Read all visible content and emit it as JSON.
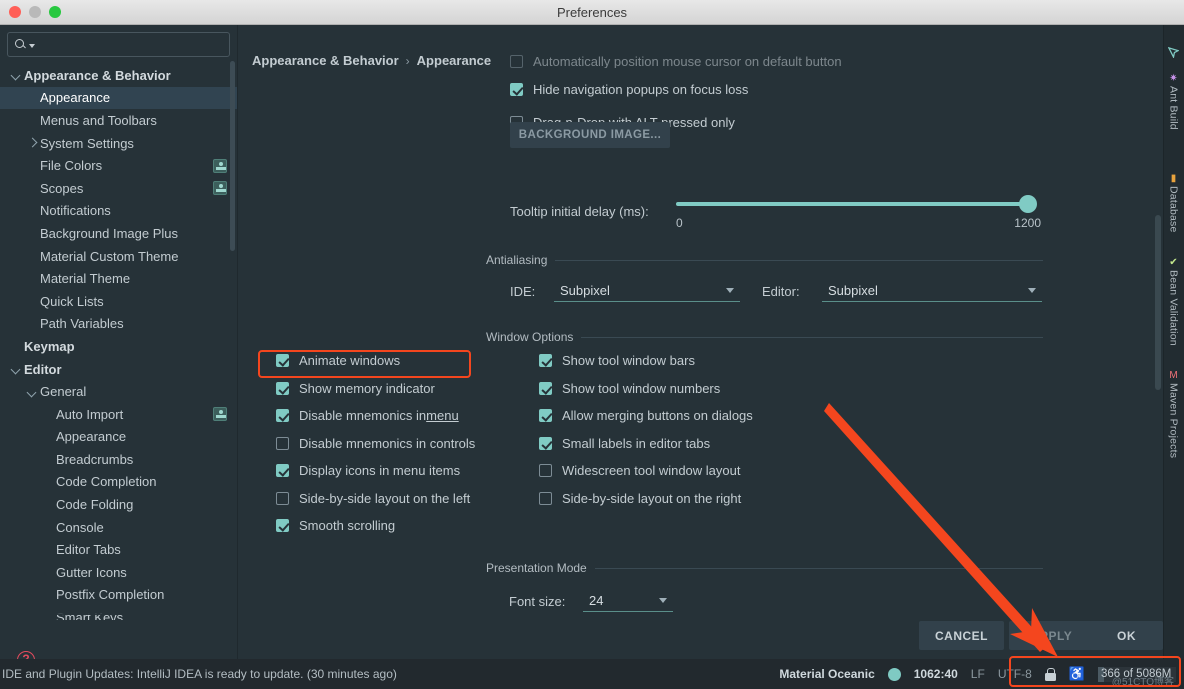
{
  "window": {
    "title": "Preferences"
  },
  "search": {
    "value": "",
    "placeholder": ""
  },
  "sidebar": {
    "items": [
      {
        "label": "Appearance & Behavior",
        "indent": 0,
        "twisty": "down",
        "bold": true,
        "selected": false,
        "badge": false
      },
      {
        "label": "Appearance",
        "indent": 1,
        "twisty": "none",
        "bold": false,
        "selected": true,
        "badge": false
      },
      {
        "label": "Menus and Toolbars",
        "indent": 1,
        "twisty": "none",
        "bold": false,
        "selected": false,
        "badge": false
      },
      {
        "label": "System Settings",
        "indent": 1,
        "twisty": "right",
        "bold": false,
        "selected": false,
        "badge": false
      },
      {
        "label": "File Colors",
        "indent": 1,
        "twisty": "none",
        "bold": false,
        "selected": false,
        "badge": true
      },
      {
        "label": "Scopes",
        "indent": 1,
        "twisty": "none",
        "bold": false,
        "selected": false,
        "badge": true
      },
      {
        "label": "Notifications",
        "indent": 1,
        "twisty": "none",
        "bold": false,
        "selected": false,
        "badge": false
      },
      {
        "label": "Background Image Plus",
        "indent": 1,
        "twisty": "none",
        "bold": false,
        "selected": false,
        "badge": false
      },
      {
        "label": "Material Custom Theme",
        "indent": 1,
        "twisty": "none",
        "bold": false,
        "selected": false,
        "badge": false
      },
      {
        "label": "Material Theme",
        "indent": 1,
        "twisty": "none",
        "bold": false,
        "selected": false,
        "badge": false
      },
      {
        "label": "Quick Lists",
        "indent": 1,
        "twisty": "none",
        "bold": false,
        "selected": false,
        "badge": false
      },
      {
        "label": "Path Variables",
        "indent": 1,
        "twisty": "none",
        "bold": false,
        "selected": false,
        "badge": false
      },
      {
        "label": "Keymap",
        "indent": 0,
        "twisty": "none",
        "bold": true,
        "selected": false,
        "badge": false
      },
      {
        "label": "Editor",
        "indent": 0,
        "twisty": "down",
        "bold": true,
        "selected": false,
        "badge": false
      },
      {
        "label": "General",
        "indent": 1,
        "twisty": "down",
        "bold": false,
        "selected": false,
        "badge": false
      },
      {
        "label": "Auto Import",
        "indent": 2,
        "twisty": "none",
        "bold": false,
        "selected": false,
        "badge": true
      },
      {
        "label": "Appearance",
        "indent": 2,
        "twisty": "none",
        "bold": false,
        "selected": false,
        "badge": false
      },
      {
        "label": "Breadcrumbs",
        "indent": 2,
        "twisty": "none",
        "bold": false,
        "selected": false,
        "badge": false
      },
      {
        "label": "Code Completion",
        "indent": 2,
        "twisty": "none",
        "bold": false,
        "selected": false,
        "badge": false
      },
      {
        "label": "Code Folding",
        "indent": 2,
        "twisty": "none",
        "bold": false,
        "selected": false,
        "badge": false
      },
      {
        "label": "Console",
        "indent": 2,
        "twisty": "none",
        "bold": false,
        "selected": false,
        "badge": false
      },
      {
        "label": "Editor Tabs",
        "indent": 2,
        "twisty": "none",
        "bold": false,
        "selected": false,
        "badge": false
      },
      {
        "label": "Gutter Icons",
        "indent": 2,
        "twisty": "none",
        "bold": false,
        "selected": false,
        "badge": false
      },
      {
        "label": "Postfix Completion",
        "indent": 2,
        "twisty": "none",
        "bold": false,
        "selected": false,
        "badge": false
      },
      {
        "label": "Smart Keys",
        "indent": 2,
        "twisty": "none",
        "bold": false,
        "selected": false,
        "badge": false
      }
    ],
    "help_label": "?"
  },
  "main": {
    "breadcrumb": {
      "root": "Appearance & Behavior",
      "separator": "›",
      "leaf": "Appearance"
    },
    "top_checks": [
      {
        "label": "Automatically position mouse cursor on default button",
        "checked": false,
        "clipped": true
      },
      {
        "label": "Hide navigation popups on focus loss",
        "checked": true,
        "clipped": false
      },
      {
        "label": "Drag-n-Drop with ALT pressed only",
        "checked": false,
        "clipped": false
      }
    ],
    "background_image_button": "BACKGROUND IMAGE...",
    "tooltip_slider": {
      "label": "Tooltip initial delay (ms):",
      "min": "0",
      "max": "1200",
      "value": 1200
    },
    "antialiasing": {
      "section": "Antialiasing",
      "ide_label": "IDE:",
      "ide_value": "Subpixel",
      "editor_label": "Editor:",
      "editor_value": "Subpixel"
    },
    "window_options": {
      "section": "Window Options",
      "left": [
        {
          "label": "Animate windows",
          "checked": true,
          "mnemonic": ""
        },
        {
          "label": "Show memory indicator",
          "checked": true,
          "mnemonic": "",
          "highlighted": true
        },
        {
          "label": "Disable mnemonics in ",
          "checked": true,
          "mnemonic": "menu"
        },
        {
          "label": "Disable mnemonics in controls",
          "checked": false,
          "mnemonic": ""
        },
        {
          "label": "Display icons in menu items",
          "checked": true,
          "mnemonic": ""
        },
        {
          "label": "Side-by-side layout on the left",
          "checked": false,
          "mnemonic": ""
        },
        {
          "label": "Smooth scrolling",
          "checked": true,
          "mnemonic": ""
        }
      ],
      "right": [
        {
          "label": "Show tool window bars",
          "checked": true
        },
        {
          "label": "Show tool window numbers",
          "checked": true
        },
        {
          "label": "Allow merging buttons on dialogs",
          "checked": true
        },
        {
          "label": "Small labels in editor tabs",
          "checked": true
        },
        {
          "label": "Widescreen tool window layout",
          "checked": false
        },
        {
          "label": "Side-by-side layout on the right",
          "checked": false
        }
      ]
    },
    "presentation_mode": {
      "section": "Presentation Mode",
      "font_size_label": "Font size:",
      "font_size_value": "24"
    }
  },
  "buttons": {
    "cancel": "CANCEL",
    "apply": "APPLY",
    "ok": "OK"
  },
  "tool_windows": [
    {
      "label": "Ant Build",
      "icon": "✷",
      "color": "#c792ea"
    },
    {
      "label": "Database",
      "icon": "▮",
      "color": "#e8a33d"
    },
    {
      "label": "Bean Validation",
      "icon": "✔",
      "color": "#c3e88d"
    },
    {
      "label": "Maven Projects",
      "icon": "M",
      "color": "#f07178"
    }
  ],
  "statusbar": {
    "message": "IDE and Plugin Updates: IntelliJ IDEA is ready to update. (30 minutes ago)",
    "theme": "Material Oceanic",
    "position": "1062:40",
    "line_separator": "LF",
    "encoding": "UTF-8",
    "memory": "366 of 5086M",
    "watermark": "@51CTO博客"
  },
  "colors": {
    "accent": "#80cbc4",
    "highlight": "#f4461e",
    "background": "#263238",
    "selected_row": "#314451"
  }
}
